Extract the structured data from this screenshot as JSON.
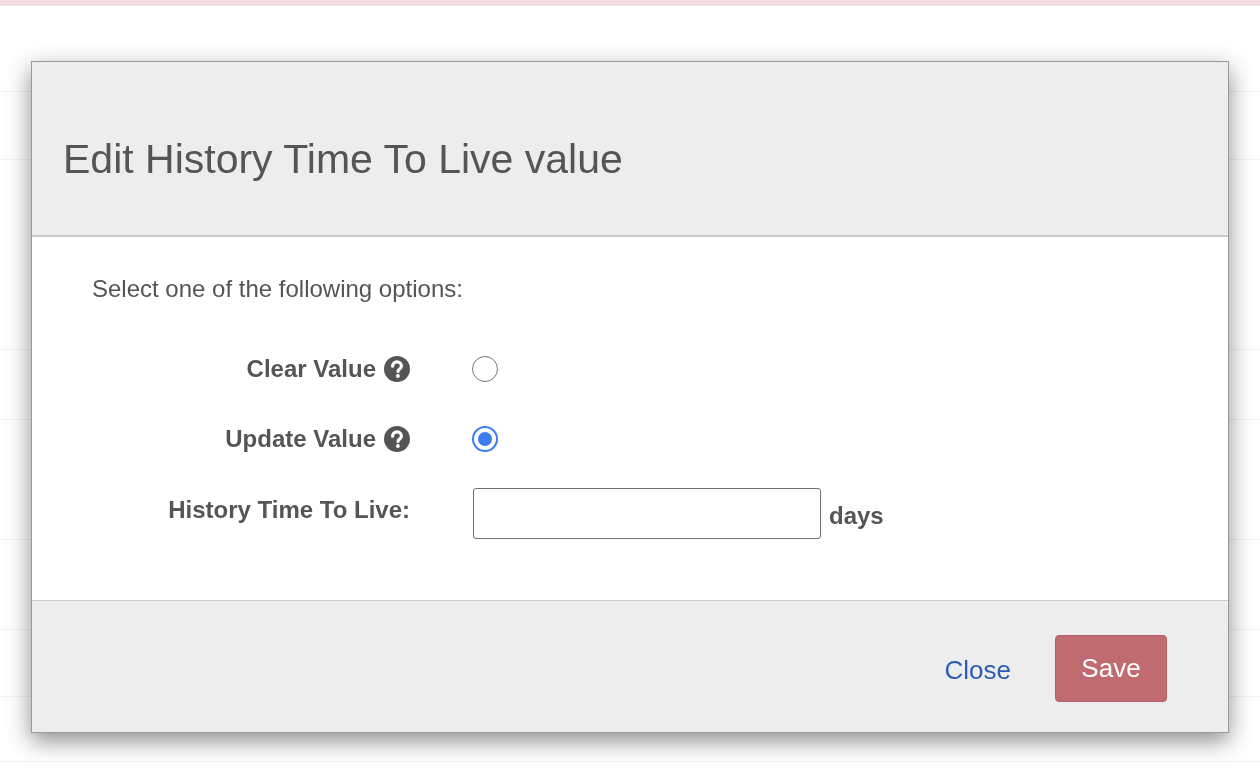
{
  "dialog": {
    "title": "Edit History Time To Live value",
    "prompt": "Select one of the following options:",
    "options": [
      {
        "label": "Clear Value",
        "selected": false
      },
      {
        "label": "Update Value",
        "selected": true
      }
    ],
    "field": {
      "label": "History Time To Live:",
      "unit": "days"
    },
    "buttons": [
      {
        "label": "Close",
        "kind": "link"
      },
      {
        "label": "Save",
        "kind": "primary"
      }
    ]
  }
}
